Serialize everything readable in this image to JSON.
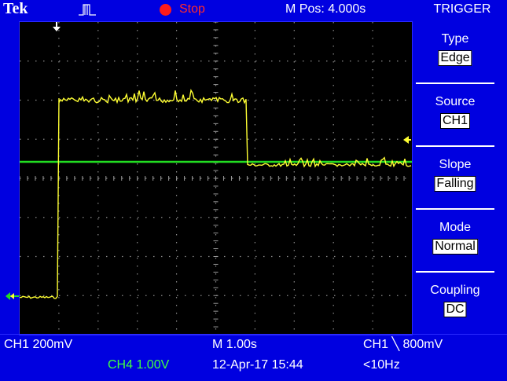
{
  "header": {
    "brand": "Tek",
    "run_state": "Stop",
    "horizontal_position": "M Pos: 4.000s",
    "menu_title": "TRIGGER"
  },
  "trigger_menu": [
    {
      "label": "Type",
      "value": "Edge"
    },
    {
      "label": "Source",
      "value": "CH1"
    },
    {
      "label": "Slope",
      "value": "Falling"
    },
    {
      "label": "Mode",
      "value": "Normal"
    },
    {
      "label": "Coupling",
      "value": "DC"
    }
  ],
  "status": {
    "ch1_scale": "CH1  200mV",
    "ch4_scale": "CH4  1.00V",
    "timebase": "M 1.00s",
    "datetime": "12-Apr-17 15:44",
    "trigger_readout": "CH1 ╲ 800mV",
    "frequency": "<10Hz"
  },
  "colors": {
    "background": "#0000e0",
    "screen": "#000000",
    "ch1_trace": "#ffff33",
    "ch4_trace": "#22dd22",
    "run_indicator": "#ff1a1a"
  },
  "icons": {
    "acquisition": "pulse-acquisition-icon",
    "trigger_position": "down-arrow-trigger-position-icon",
    "trigger_level": "left-arrow-trigger-level-icon",
    "ch1_ground": "ch1-ground-marker-icon"
  }
}
